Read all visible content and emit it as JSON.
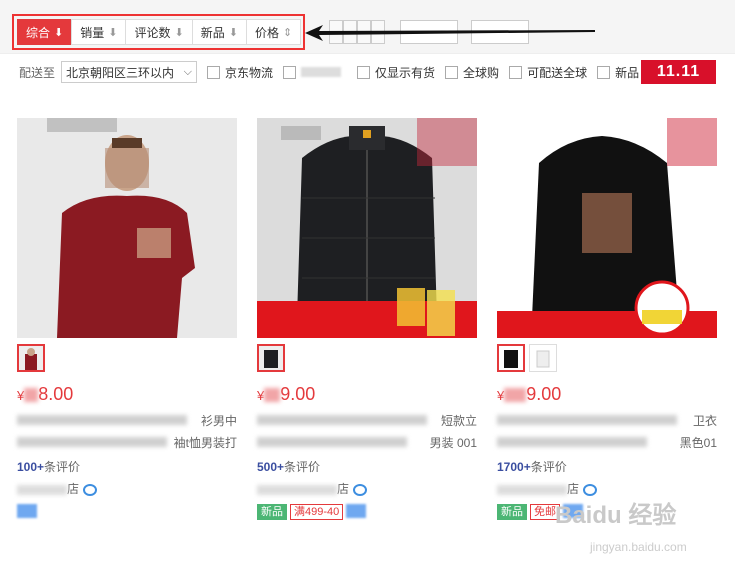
{
  "sort": {
    "items": [
      {
        "label": "综合",
        "arrow": "⬇",
        "active": true
      },
      {
        "label": "销量",
        "arrow": "⬇",
        "active": false
      },
      {
        "label": "评论数",
        "arrow": "⬇",
        "active": false
      },
      {
        "label": "新品",
        "arrow": "⬇",
        "active": false
      },
      {
        "label": "价格",
        "arrow": "⇕",
        "active": false
      }
    ]
  },
  "filters": {
    "deliver_label": "配送至",
    "address": "北京朝阳区三环以内",
    "options": [
      "京东物流",
      "仅显示有货",
      "全球购",
      "可配送全球",
      "新品"
    ],
    "promo_badge": "11.11"
  },
  "products": [
    {
      "price_prefix": "¥",
      "price_visible": "8.00",
      "title_end_1": "衫男中",
      "title_end_2": "袖t恤男装打",
      "reviews_count": "100+",
      "reviews_suffix": "条评价",
      "shop_suffix": "店",
      "tags": []
    },
    {
      "price_prefix": "¥",
      "price_visible": "9.00",
      "title_end_1": "短款立",
      "title_end_2": "男装 001",
      "reviews_count": "500+",
      "reviews_suffix": "条评价",
      "shop_suffix": "店",
      "tags": [
        {
          "text": "新品",
          "style": "green"
        },
        {
          "text": "满499-40",
          "style": "red"
        }
      ]
    },
    {
      "price_prefix": "¥",
      "price_visible": "9.00",
      "title_end_1": "卫衣",
      "title_end_2": "黑色01",
      "reviews_count": "1700+",
      "reviews_suffix": "条评价",
      "shop_suffix": "店",
      "tags": [
        {
          "text": "新品",
          "style": "green"
        },
        {
          "text": "免邮",
          "style": "red"
        }
      ]
    }
  ],
  "watermark": {
    "text": "Baidu 经验",
    "sub": "jingyan.baidu.com"
  },
  "colors": {
    "accent": "#e4393c",
    "highlight_border": "#e33"
  }
}
